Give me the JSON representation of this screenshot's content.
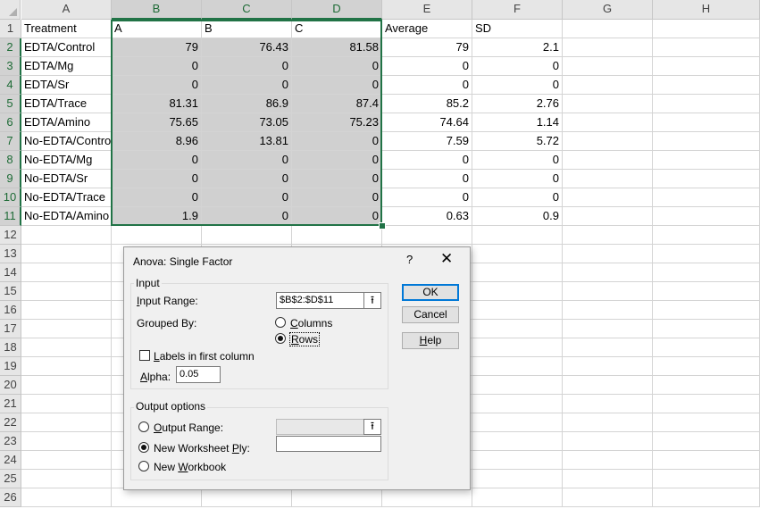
{
  "columns": [
    "A",
    "B",
    "C",
    "D",
    "E",
    "F",
    "G",
    "H"
  ],
  "rows": [
    "1",
    "2",
    "3",
    "4",
    "5",
    "6",
    "7",
    "8",
    "9",
    "10",
    "11",
    "12",
    "13",
    "14",
    "15",
    "16",
    "17",
    "18",
    "19",
    "20",
    "21",
    "22",
    "23",
    "24",
    "25",
    "26"
  ],
  "header_row": [
    "Treatment",
    "A",
    "B",
    "C",
    "Average",
    "SD"
  ],
  "data": [
    [
      "EDTA/Control",
      "79",
      "76.43",
      "81.58",
      "79",
      "2.1"
    ],
    [
      "EDTA/Mg",
      "0",
      "0",
      "0",
      "0",
      "0"
    ],
    [
      "EDTA/Sr",
      "0",
      "0",
      "0",
      "0",
      "0"
    ],
    [
      "EDTA/Trace",
      "81.31",
      "86.9",
      "87.4",
      "85.2",
      "2.76"
    ],
    [
      "EDTA/Amino",
      "75.65",
      "73.05",
      "75.23",
      "74.64",
      "1.14"
    ],
    [
      "No-EDTA/Control",
      "8.96",
      "13.81",
      "0",
      "7.59",
      "5.72"
    ],
    [
      "No-EDTA/Mg",
      "0",
      "0",
      "0",
      "0",
      "0"
    ],
    [
      "No-EDTA/Sr",
      "0",
      "0",
      "0",
      "0",
      "0"
    ],
    [
      "No-EDTA/Trace",
      "0",
      "0",
      "0",
      "0",
      "0"
    ],
    [
      "No-EDTA/Amino",
      "1.9",
      "0",
      "0",
      "0.63",
      "0.9"
    ]
  ],
  "dialog": {
    "title": "Anova: Single Factor",
    "help_symbol": "?",
    "close_symbol": "✕",
    "input_group": "Input",
    "input_range_label": "Input Range:",
    "input_range_value": "$B$2:$D$11",
    "grouped_by_label": "Grouped By:",
    "columns_label": "Columns",
    "rows_label": "Rows",
    "labels_first_col": "Labels in first column",
    "alpha_label": "Alpha:",
    "alpha_value": "0.05",
    "output_group": "Output options",
    "output_range_label": "Output Range:",
    "new_ws_label": "New Worksheet Ply:",
    "new_wb_label": "New Workbook",
    "ok_label": "OK",
    "cancel_label": "Cancel",
    "help_label": "Help",
    "ref_icon": "⭱"
  }
}
